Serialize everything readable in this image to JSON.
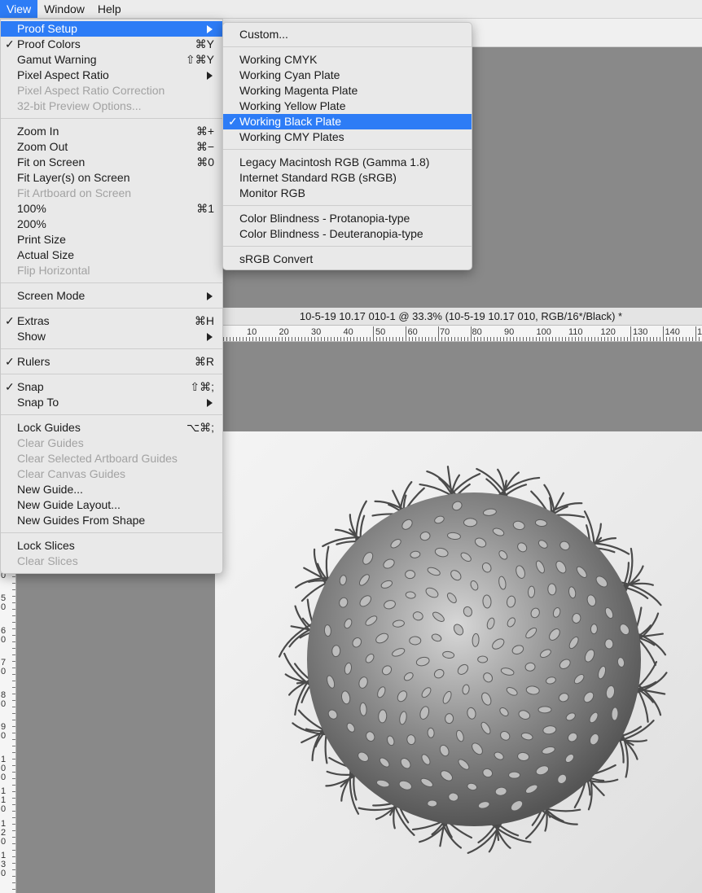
{
  "menubar": {
    "items": [
      "View",
      "Window",
      "Help"
    ]
  },
  "document": {
    "title": "10-5-19 10.17 010-1 @ 33.3% (10-5-19 10.17 010, RGB/16*/Black) *"
  },
  "ruler_h": {
    "labels": [
      "10",
      "20",
      "30",
      "40",
      "50",
      "60",
      "70",
      "80",
      "90",
      "100",
      "110",
      "120",
      "130",
      "140",
      "1"
    ]
  },
  "ruler_v": {
    "labels": [
      "0",
      "5\n0",
      "6\n0",
      "7\n0",
      "8\n0",
      "9\n0",
      "1\n0\n0",
      "1\n1\n0",
      "1\n2\n0",
      "1\n3\n0"
    ]
  },
  "view_menu": {
    "items": [
      {
        "label": "Proof Setup",
        "submenu": true,
        "highlighted": true
      },
      {
        "label": "Proof Colors",
        "checked": true,
        "shortcut": "⌘Y"
      },
      {
        "label": "Gamut Warning",
        "shortcut": "⇧⌘Y"
      },
      {
        "label": "Pixel Aspect Ratio",
        "submenu": true
      },
      {
        "label": "Pixel Aspect Ratio Correction",
        "disabled": true
      },
      {
        "label": "32-bit Preview Options...",
        "disabled": true
      },
      {
        "sep": true
      },
      {
        "label": "Zoom In",
        "shortcut": "⌘+"
      },
      {
        "label": "Zoom Out",
        "shortcut": "⌘−"
      },
      {
        "label": "Fit on Screen",
        "shortcut": "⌘0"
      },
      {
        "label": "Fit Layer(s) on Screen"
      },
      {
        "label": "Fit Artboard on Screen",
        "disabled": true
      },
      {
        "label": "100%",
        "shortcut": "⌘1"
      },
      {
        "label": "200%"
      },
      {
        "label": "Print Size"
      },
      {
        "label": "Actual Size"
      },
      {
        "label": "Flip Horizontal",
        "disabled": true
      },
      {
        "sep": true
      },
      {
        "label": "Screen Mode",
        "submenu": true
      },
      {
        "sep": true
      },
      {
        "label": "Extras",
        "checked": true,
        "shortcut": "⌘H"
      },
      {
        "label": "Show",
        "submenu": true
      },
      {
        "sep": true
      },
      {
        "label": "Rulers",
        "checked": true,
        "shortcut": "⌘R"
      },
      {
        "sep": true
      },
      {
        "label": "Snap",
        "checked": true,
        "shortcut": "⇧⌘;"
      },
      {
        "label": "Snap To",
        "submenu": true
      },
      {
        "sep": true
      },
      {
        "label": "Lock Guides",
        "shortcut": "⌥⌘;"
      },
      {
        "label": "Clear Guides",
        "disabled": true
      },
      {
        "label": "Clear Selected Artboard Guides",
        "disabled": true
      },
      {
        "label": "Clear Canvas Guides",
        "disabled": true
      },
      {
        "label": "New Guide..."
      },
      {
        "label": "New Guide Layout..."
      },
      {
        "label": "New Guides From Shape"
      },
      {
        "sep": true
      },
      {
        "label": "Lock Slices"
      },
      {
        "label": "Clear Slices",
        "disabled": true
      }
    ]
  },
  "proof_submenu": {
    "items": [
      {
        "label": "Custom..."
      },
      {
        "sep": true
      },
      {
        "label": "Working CMYK"
      },
      {
        "label": "Working Cyan Plate"
      },
      {
        "label": "Working Magenta Plate"
      },
      {
        "label": "Working Yellow Plate"
      },
      {
        "label": "Working Black Plate",
        "checked": true,
        "highlighted": true
      },
      {
        "label": "Working CMY Plates"
      },
      {
        "sep": true
      },
      {
        "label": "Legacy Macintosh RGB (Gamma 1.8)"
      },
      {
        "label": "Internet Standard RGB (sRGB)"
      },
      {
        "label": "Monitor RGB"
      },
      {
        "sep": true
      },
      {
        "label": "Color Blindness - Protanopia-type"
      },
      {
        "label": "Color Blindness - Deuteranopia-type"
      },
      {
        "sep": true
      },
      {
        "label": "sRGB Convert"
      }
    ]
  },
  "colors": {
    "highlight": "#2d7cf6",
    "menu_bg": "#e9e9e9",
    "pasteboard": "#898989"
  }
}
